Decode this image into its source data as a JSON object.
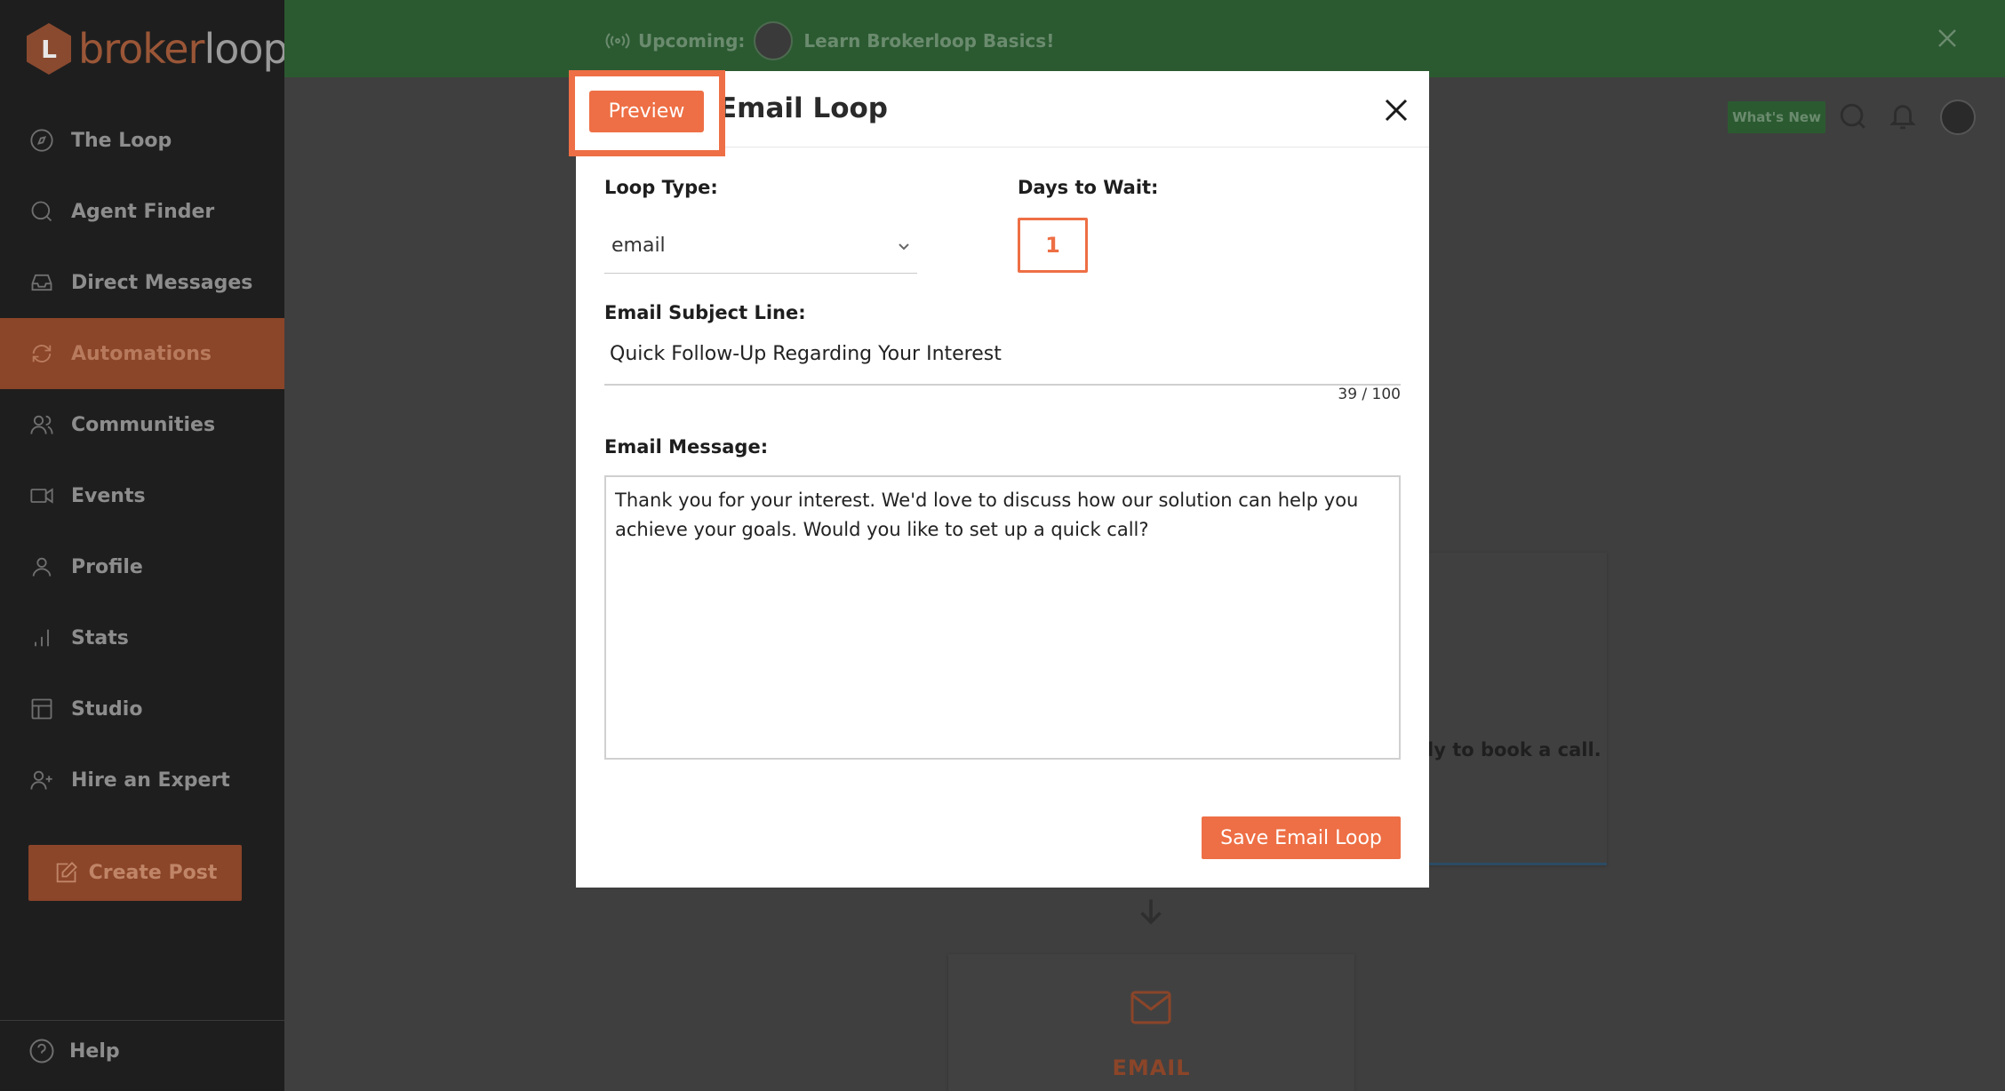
{
  "brand": {
    "logo_text_1": "broker",
    "logo_text_2": "loop",
    "logo_mark": "L"
  },
  "sidebar": {
    "items": [
      {
        "label": "The Loop",
        "icon": "compass-icon"
      },
      {
        "label": "Agent Finder",
        "icon": "search-icon"
      },
      {
        "label": "Direct Messages",
        "icon": "inbox-icon"
      },
      {
        "label": "Automations",
        "icon": "refresh-icon",
        "active": true
      },
      {
        "label": "Communities",
        "icon": "users-icon"
      },
      {
        "label": "Events",
        "icon": "video-icon"
      },
      {
        "label": "Profile",
        "icon": "user-icon"
      },
      {
        "label": "Stats",
        "icon": "bar-chart-icon"
      },
      {
        "label": "Studio",
        "icon": "layout-icon"
      },
      {
        "label": "Hire an Expert",
        "icon": "user-plus-icon"
      }
    ],
    "create_post": "Create Post",
    "help": "Help"
  },
  "banner": {
    "upcoming_label": "Upcoming:",
    "event_title": "Learn Brokerloop Basics!"
  },
  "header": {
    "whats_new": "What's New"
  },
  "background": {
    "card_text": "ly to book a call.",
    "email_card_label": "EMAIL"
  },
  "modal": {
    "title": "Email Loop",
    "preview_button": "Preview",
    "loop_type_label": "Loop Type:",
    "loop_type_value": "email",
    "days_label": "Days to Wait:",
    "days_value": "1",
    "subject_label": "Email Subject Line:",
    "subject_value": "Quick Follow-Up Regarding Your Interest",
    "subject_counter": "39 / 100",
    "message_label": "Email Message:",
    "message_value": "Thank you for your interest. We'd love to discuss how our solution can help you achieve your goals. Would you like to set up a quick call?",
    "save_button": "Save Email Loop"
  },
  "colors": {
    "accent": "#ee6f45",
    "sidebar_bg": "#1e1e1e",
    "banner_bg": "#2b5a31"
  }
}
